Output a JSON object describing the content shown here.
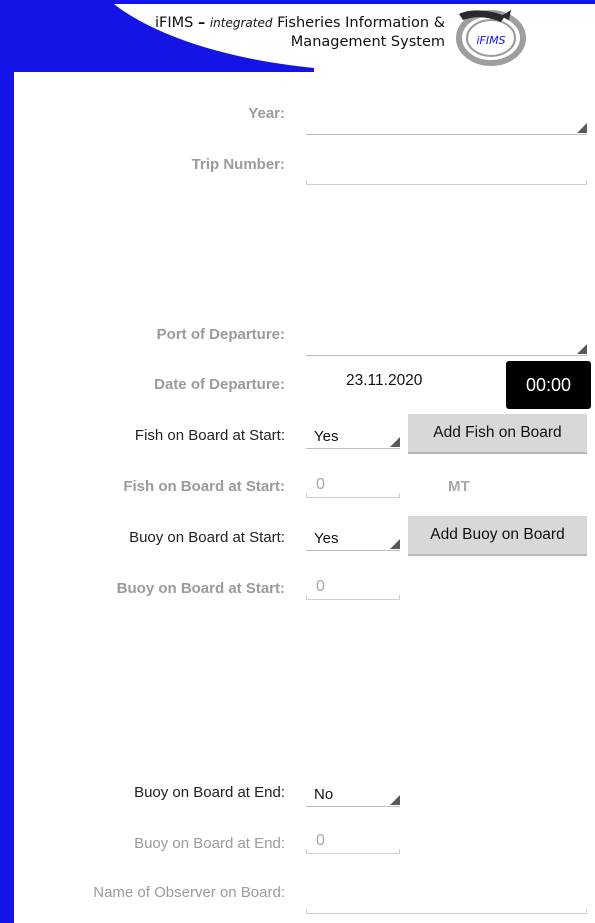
{
  "header": {
    "brand": "iFIMS",
    "dash": "–",
    "integrated": "integrated",
    "title_rest": "Fisheries Information &",
    "title_line2": "Management System",
    "logo_text": "iFIMS"
  },
  "colors": {
    "frame": "#1414e6",
    "button": "#d8d8d8",
    "time_button": "#000000"
  },
  "form": {
    "year_label": "Year:",
    "year_value": "",
    "trip_number_label": "Trip Number:",
    "trip_number_value": "",
    "port_departure_label": "Port of Departure:",
    "port_departure_value": "",
    "date_departure_label": "Date of Departure:",
    "date_departure_value": "23.11.2020",
    "time_departure_value": "00:00",
    "fish_start_label": "Fish on Board at Start:",
    "fish_start_select": "Yes",
    "add_fish_button": "Add Fish on Board",
    "fish_start_qty_label": "Fish on Board at Start:",
    "fish_start_qty_placeholder": "0",
    "fish_unit": "MT",
    "buoy_start_label": "Buoy on Board at Start:",
    "buoy_start_select": "Yes",
    "add_buoy_button": "Add Buoy on Board",
    "buoy_start_qty_label": "Buoy on Board at Start:",
    "buoy_start_qty_placeholder": "0",
    "buoy_end_label": "Buoy on Board at End:",
    "buoy_end_select": "No",
    "buoy_end_qty_label": "Buoy on Board at End:",
    "buoy_end_qty_placeholder": "0",
    "observer_label": "Name of Observer on Board:",
    "observer_value": ""
  }
}
